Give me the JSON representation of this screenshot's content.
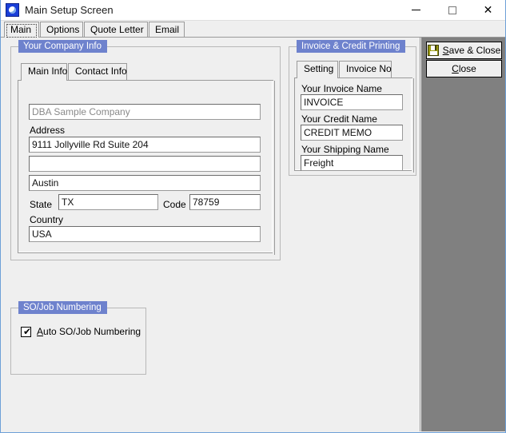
{
  "window": {
    "title": "Main Setup Screen",
    "icon": "app-icon",
    "controls": {
      "minimize": "—",
      "maximize": "□",
      "close": "✕"
    }
  },
  "tabs": [
    {
      "label": "Main",
      "active": true
    },
    {
      "label": "Options",
      "active": false
    },
    {
      "label": "Quote Letter",
      "active": false
    },
    {
      "label": "Email",
      "active": false
    }
  ],
  "company_group": {
    "legend": "Your Company Info",
    "subtabs": [
      {
        "label": "Main Info",
        "active": true
      },
      {
        "label": "Contact Info",
        "active": false
      }
    ],
    "fields": {
      "dba_value": "DBA Sample Company",
      "address_label": "Address",
      "address1": "9111 Jollyville Rd Suite 204",
      "address2": "",
      "city": "Austin",
      "state_label": "State",
      "state": "TX",
      "code_label": "Code",
      "code": "78759",
      "country_label": "Country",
      "country": "USA"
    }
  },
  "invoice_group": {
    "legend": "Invoice & Credit Printing",
    "subtabs": [
      {
        "label": "Setting",
        "active": true
      },
      {
        "label": "Invoice No",
        "active": false
      }
    ],
    "fields": {
      "invoice_name_label": "Your Invoice Name",
      "invoice_name": "INVOICE",
      "credit_name_label": "Your Credit Name",
      "credit_name": "CREDIT MEMO",
      "shipping_name_label": "Your Shipping Name",
      "shipping_name": "Freight"
    }
  },
  "sojob_group": {
    "legend": "SO/Job Numbering",
    "checkbox": {
      "label_accel": "A",
      "label_rest": "uto SO/Job Numbering",
      "checked": true,
      "tick": "✔"
    }
  },
  "actions": {
    "save_close_accel": "S",
    "save_close_pre": "",
    "save_close_rest": "ave & Close",
    "close_accel": "C",
    "close_rest": "lose",
    "save_icon": "floppy-disk-icon"
  },
  "colors": {
    "legend_bg": "#6e82cd",
    "legend_fg": "#ffffff",
    "sidebar_bg": "#808080",
    "window_bg": "#efefef",
    "window_border": "#6ea0d8",
    "save_icon": "#9a9a12"
  }
}
